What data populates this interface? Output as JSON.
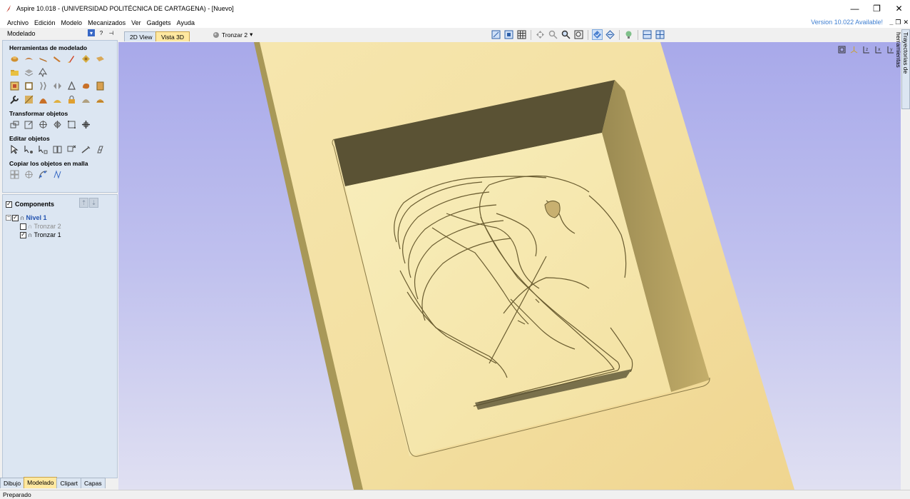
{
  "window": {
    "title": "Aspire 10.018 - (UNIVERSIDAD POLITÉCNICA DE CARTAGENA) - [Nuevo]",
    "minimize": "—",
    "restore": "❐",
    "close": "✕"
  },
  "menu": {
    "items": [
      "Archivo",
      "Edición",
      "Modelo",
      "Mecanizados",
      "Ver",
      "Gadgets",
      "Ayuda"
    ],
    "version_notice": "Version 10.022 Available!",
    "mdi_minimize": "_",
    "mdi_restore": "❐",
    "mdi_close": "✕"
  },
  "left_panel": {
    "header": "Modelado",
    "help": "?",
    "pin": "⊣",
    "sections": {
      "modeling_tools": "Herramientas de modelado",
      "transform": "Transformar objetos",
      "edit": "Editar objetos",
      "copy_grid": "Copiar los objetos en malla"
    },
    "components": {
      "title": "Components",
      "up": "⇡",
      "down": "⇣",
      "level": "Nivel 1",
      "items": [
        "Tronzar 2",
        "Tronzar 1"
      ]
    },
    "tabs": [
      "Dibujo",
      "Modelado",
      "Clipart",
      "Capas"
    ],
    "active_tab": "Modelado"
  },
  "view": {
    "tab_2d": "2D View",
    "tab_3d": "Vista 3D",
    "toolpath_select": "Tronzar 2"
  },
  "right_tab": "Trayectorias de herramientas",
  "status": "Preparado",
  "colors": {
    "material": "#f0dca0",
    "pocket_wall": "#5a5234",
    "accent_tab": "#ffe8a0",
    "panel": "#dce6f2",
    "link": "#3f7fd1"
  }
}
